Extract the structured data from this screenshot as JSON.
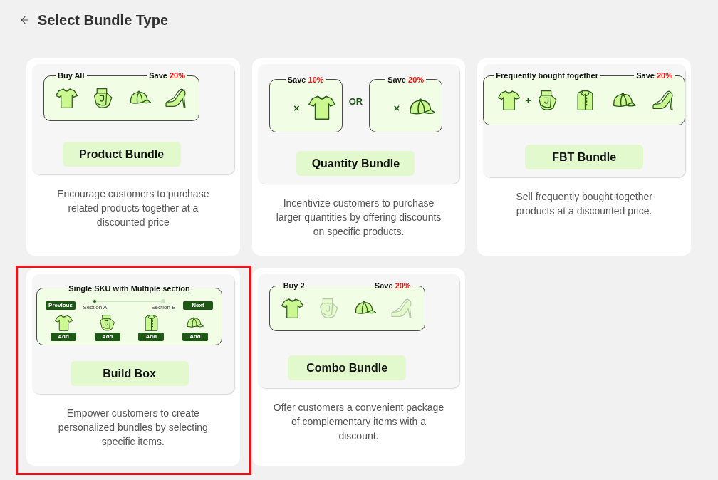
{
  "header": {
    "title": "Select Bundle Type"
  },
  "bundles": [
    {
      "kind": "product",
      "selected": false,
      "name": "Product Bundle",
      "description": "Encourage customers to purchase related products together at a discounted price",
      "illustration": {
        "title": "Buy All",
        "save": {
          "label": "Save",
          "value": "20%"
        }
      }
    },
    {
      "kind": "quantity",
      "selected": false,
      "name": "Quantity Bundle",
      "description": "Incentivize customers to purchase larger quantities by offering discounts on specific products.",
      "illustration": {
        "offers": [
          {
            "save": {
              "label": "Save",
              "value": "10%"
            },
            "multiplier": "×"
          },
          {
            "save": {
              "label": "Save",
              "value": "20%"
            },
            "multiplier": "×"
          }
        ],
        "separator": "OR"
      }
    },
    {
      "kind": "fbt",
      "selected": false,
      "name": "FBT Bundle",
      "description": "Sell frequently bought-together products at a discounted price.",
      "illustration": {
        "title": "Frequently bought together",
        "save": {
          "label": "Save",
          "value": "20%"
        },
        "plus": "+"
      }
    },
    {
      "kind": "build",
      "selected": true,
      "name": "Build Box",
      "description": "Empower customers to create personalized bundles by selecting specific items.",
      "illustration": {
        "title": "Single SKU with Multiple section",
        "previous": "Previous",
        "next": "Next",
        "steps": [
          {
            "label": "Section A",
            "selected": true
          },
          {
            "label": "Section B",
            "selected": false
          }
        ],
        "add_buttons": [
          "Add",
          "Add",
          "Add",
          "Add"
        ]
      }
    },
    {
      "kind": "combo",
      "selected": false,
      "name": "Combo Bundle",
      "description": "Offer customers a convenient package of complementary items with a discount.",
      "illustration": {
        "title": "Buy 2",
        "save": {
          "label": "Save",
          "value": "20%"
        },
        "items": [
          {
            "selected": true
          },
          {
            "selected": false
          },
          {
            "selected": true
          },
          {
            "selected": false
          }
        ]
      }
    }
  ]
}
